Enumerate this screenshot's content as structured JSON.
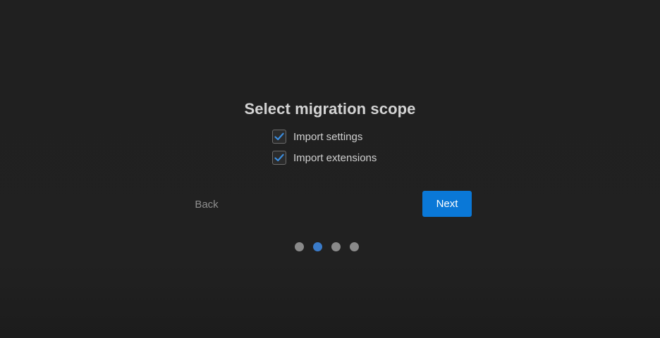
{
  "title": "Select migration scope",
  "options": [
    {
      "label": "Import settings",
      "checked": true
    },
    {
      "label": "Import extensions",
      "checked": true
    }
  ],
  "navigation": {
    "back_label": "Back",
    "next_label": "Next"
  },
  "steps": {
    "total": 4,
    "current": 2
  },
  "colors": {
    "accent": "#0a78d7",
    "check": "#3b8ee0",
    "active_dot": "#3a7bc9",
    "inactive_dot": "#8a8a8a"
  }
}
